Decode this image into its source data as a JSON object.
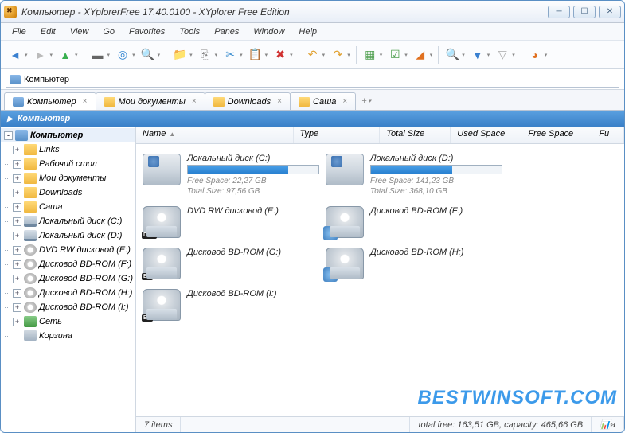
{
  "title": "Компьютер - XYplorerFree 17.40.0100 - XYplorer Free Edition",
  "menu": [
    "File",
    "Edit",
    "View",
    "Go",
    "Favorites",
    "Tools",
    "Panes",
    "Window",
    "Help"
  ],
  "address": "Компьютер",
  "tabs": [
    {
      "label": "Компьютер",
      "icon": "pc",
      "active": true
    },
    {
      "label": "Мои документы",
      "icon": "folder"
    },
    {
      "label": "Downloads",
      "icon": "folder"
    },
    {
      "label": "Саша",
      "icon": "folder"
    }
  ],
  "path": "Компьютер",
  "tree": [
    {
      "label": "Компьютер",
      "icon": "pc",
      "root": true,
      "exp": "-"
    },
    {
      "label": "Links",
      "icon": "folder",
      "exp": "+"
    },
    {
      "label": "Рабочий стол",
      "icon": "folder",
      "exp": "+"
    },
    {
      "label": "Мои документы",
      "icon": "folder",
      "exp": "+"
    },
    {
      "label": "Downloads",
      "icon": "folder",
      "exp": "+"
    },
    {
      "label": "Саша",
      "icon": "folder",
      "exp": "+"
    },
    {
      "label": "Локальный диск (C:)",
      "icon": "drive",
      "exp": "+"
    },
    {
      "label": "Локальный диск (D:)",
      "icon": "drive",
      "exp": "+"
    },
    {
      "label": "DVD RW дисковод (E:)",
      "icon": "dvd",
      "exp": "+"
    },
    {
      "label": "Дисковод BD-ROM (F:)",
      "icon": "dvd",
      "exp": "+"
    },
    {
      "label": "Дисковод BD-ROM (G:)",
      "icon": "dvd",
      "exp": "+"
    },
    {
      "label": "Дисковод BD-ROM (H:)",
      "icon": "dvd",
      "exp": "+"
    },
    {
      "label": "Дисковод BD-ROM (I:)",
      "icon": "dvd",
      "exp": "+"
    },
    {
      "label": "Сеть",
      "icon": "net",
      "exp": "+"
    },
    {
      "label": "Корзина",
      "icon": "trash",
      "exp": ""
    }
  ],
  "columns": [
    "Name",
    "Type",
    "Total Size",
    "Used Space",
    "Free Space",
    "Fu"
  ],
  "drives": [
    {
      "name": "Локальный диск (C:)",
      "kind": "hdd",
      "free": "Free Space: 22,27 GB",
      "total": "Total Size: 97,56 GB",
      "fill": 77
    },
    {
      "name": "Локальный диск (D:)",
      "kind": "hdd",
      "free": "Free Space: 141,23 GB",
      "total": "Total Size: 368,10 GB",
      "fill": 62
    },
    {
      "name": "DVD RW дисковод (E:)",
      "kind": "disc",
      "badge": "DVD"
    },
    {
      "name": "Дисковод BD-ROM (F:)",
      "kind": "disc",
      "badge": "BD",
      "extra": true
    },
    {
      "name": "Дисковод BD-ROM (G:)",
      "kind": "disc",
      "badge": "BD"
    },
    {
      "name": "Дисковод BD-ROM (H:)",
      "kind": "disc",
      "badge": "BD",
      "extra": true
    },
    {
      "name": "Дисковод BD-ROM (I:)",
      "kind": "disc",
      "badge": "BD"
    }
  ],
  "status": {
    "items": "7 items",
    "totals": "total free: 163,51 GB, capacity: 465,66 GB",
    "extra": "a"
  },
  "watermark": "BESTWINSOFT.COM",
  "toolbar_icons": [
    {
      "name": "back-icon",
      "glyph": "◄",
      "color": "#3a80d0"
    },
    {
      "name": "forward-icon",
      "glyph": "►",
      "color": "#bbb"
    },
    {
      "name": "up-icon",
      "glyph": "▲",
      "color": "#3ab050"
    },
    {
      "name": "sep"
    },
    {
      "name": "desktop-icon",
      "glyph": "▬",
      "color": "#666"
    },
    {
      "name": "target-icon",
      "glyph": "◎",
      "color": "#2a80d0"
    },
    {
      "name": "zoom-icon",
      "glyph": "🔍",
      "color": "#2a80d0"
    },
    {
      "name": "sep"
    },
    {
      "name": "new-folder-icon",
      "glyph": "📁",
      "color": "#e0a030"
    },
    {
      "name": "copy-icon",
      "glyph": "⎘",
      "color": "#888"
    },
    {
      "name": "cut-icon",
      "glyph": "✂",
      "color": "#4090d0"
    },
    {
      "name": "paste-icon",
      "glyph": "📋",
      "color": "#888"
    },
    {
      "name": "delete-icon",
      "glyph": "✖",
      "color": "#d03030"
    },
    {
      "name": "sep"
    },
    {
      "name": "undo-icon",
      "glyph": "↶",
      "color": "#e0a030"
    },
    {
      "name": "redo-icon",
      "glyph": "↷",
      "color": "#e0a030"
    },
    {
      "name": "sep"
    },
    {
      "name": "select-icon",
      "glyph": "▦",
      "color": "#50a050"
    },
    {
      "name": "check-icon",
      "glyph": "☑",
      "color": "#50a050"
    },
    {
      "name": "pizza-icon",
      "glyph": "◢",
      "color": "#e07020"
    },
    {
      "name": "sep"
    },
    {
      "name": "find-icon",
      "glyph": "🔍",
      "color": "#3a80d0"
    },
    {
      "name": "filter-icon",
      "glyph": "▼",
      "color": "#3a80d0"
    },
    {
      "name": "nofilter-icon",
      "glyph": "▽",
      "color": "#aaa"
    },
    {
      "name": "sep"
    },
    {
      "name": "pie-icon",
      "glyph": "◕",
      "color": "#e07020"
    }
  ]
}
